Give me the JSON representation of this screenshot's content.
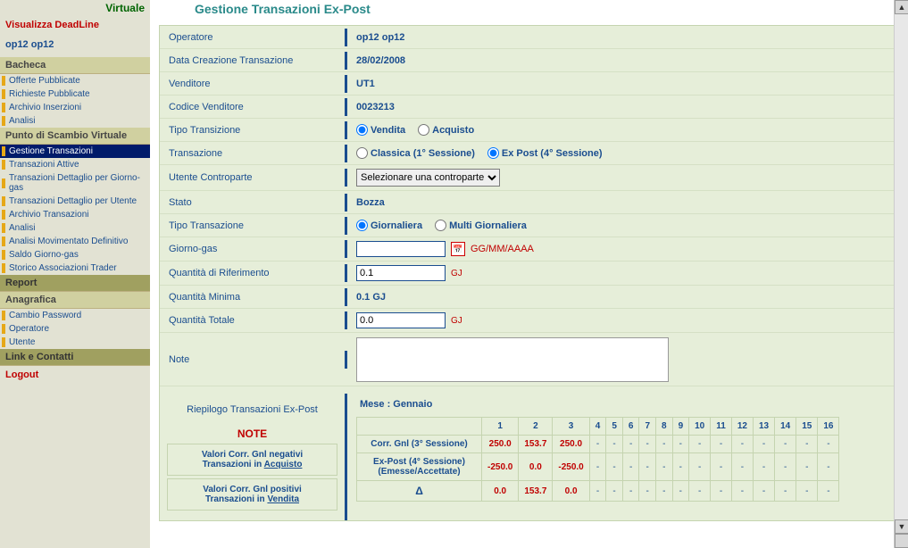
{
  "sidebar": {
    "top_label": "Virtuale",
    "deadline": "Visualizza DeadLine",
    "user": "op12 op12",
    "sections": {
      "bacheca": {
        "title": "Bacheca",
        "items": [
          "Offerte Pubblicate",
          "Richieste Pubblicate",
          "Archivio Inserzioni",
          "Analisi"
        ]
      },
      "psv": {
        "title": "Punto di Scambio Virtuale",
        "items": [
          "Gestione Transazioni",
          "Transazioni Attive",
          "Transazioni Dettaglio per Giorno-gas",
          "Transazioni Dettaglio per Utente",
          "Archivio Transazioni",
          "Analisi",
          "Analisi Movimentato Definitivo",
          "Saldo Giorno-gas",
          "Storico Associazioni Trader"
        ],
        "active_index": 0
      },
      "report": {
        "title": "Report"
      },
      "anagrafica": {
        "title": "Anagrafica",
        "items": [
          "Cambio Password",
          "Operatore",
          "Utente"
        ]
      },
      "link": {
        "title": "Link e Contatti"
      }
    },
    "logout": "Logout"
  },
  "page": {
    "title": "Gestione Transazioni Ex-Post"
  },
  "form": {
    "operatore": {
      "label": "Operatore",
      "value": "op12 op12"
    },
    "data_creazione": {
      "label": "Data Creazione Transazione",
      "value": "28/02/2008"
    },
    "venditore": {
      "label": "Venditore",
      "value": "UT1"
    },
    "codice_venditore": {
      "label": "Codice Venditore",
      "value": "0023213"
    },
    "tipo_transizione": {
      "label": "Tipo Transizione",
      "options": [
        "Vendita",
        "Acquisto"
      ],
      "selected": 0
    },
    "transazione": {
      "label": "Transazione",
      "options": [
        "Classica (1° Sessione)",
        "Ex Post (4° Sessione)"
      ],
      "selected": 1
    },
    "utente_controparte": {
      "label": "Utente Controparte",
      "placeholder": "Selezionare una controparte"
    },
    "stato": {
      "label": "Stato",
      "value": "Bozza"
    },
    "tipo_transazione": {
      "label": "Tipo Transazione",
      "options": [
        "Giornaliera",
        "Multi Giornaliera"
      ],
      "selected": 0
    },
    "giorno_gas": {
      "label": "Giorno-gas",
      "value": "",
      "hint": "GG/MM/AAAA"
    },
    "quantita_rif": {
      "label": "Quantità di Riferimento",
      "value": "0.1",
      "unit": "GJ"
    },
    "quantita_min": {
      "label": "Quantità Minima",
      "value": "0.1 GJ"
    },
    "quantita_tot": {
      "label": "Quantità Totale",
      "value": "0.0",
      "unit": "GJ"
    },
    "note": {
      "label": "Note",
      "value": ""
    }
  },
  "summary": {
    "title": "Riepilogo Transazioni Ex-Post",
    "note_title": "NOTE",
    "note1_line1": "Valori Corr. Gnl negativi",
    "note1_line2_prefix": "Transazioni in ",
    "note1_line2_link": "Acquisto",
    "note2_line1": "Valori Corr. Gnl positivi",
    "note2_line2_prefix": "Transazioni in ",
    "note2_line2_link": "Vendita",
    "month_label": "Mese : Gennaio",
    "days": [
      "1",
      "2",
      "3",
      "4",
      "5",
      "6",
      "7",
      "8",
      "9",
      "10",
      "11",
      "12",
      "13",
      "14",
      "15",
      "16"
    ],
    "rows": [
      {
        "label": "Corr. Gnl (3° Sessione)",
        "values": [
          "250.0",
          "153.7",
          "250.0",
          "-",
          "-",
          "-",
          "-",
          "-",
          "-",
          "-",
          "-",
          "-",
          "-",
          "-",
          "-",
          "-"
        ]
      },
      {
        "label": "Ex-Post (4° Sessione) (Emesse/Accettate)",
        "values": [
          "-250.0",
          "0.0",
          "-250.0",
          "-",
          "-",
          "-",
          "-",
          "-",
          "-",
          "-",
          "-",
          "-",
          "-",
          "-",
          "-",
          "-"
        ]
      },
      {
        "label": "Δ",
        "values": [
          "0.0",
          "153.7",
          "0.0",
          "-",
          "-",
          "-",
          "-",
          "-",
          "-",
          "-",
          "-",
          "-",
          "-",
          "-",
          "-",
          "-"
        ],
        "delta": true
      }
    ]
  }
}
